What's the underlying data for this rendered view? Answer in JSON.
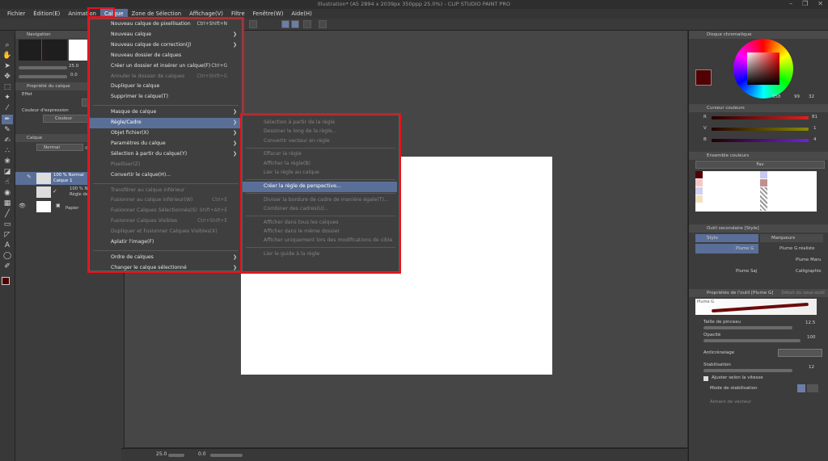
{
  "window": {
    "title": "Illustration* (A5 2894 x 2039px 350ppp 25.0%) - CLIP STUDIO PAINT PRO",
    "controls": [
      "–",
      "❐",
      "✕"
    ]
  },
  "menubar": [
    "Fichier",
    "Édition(E)",
    "Animation",
    "Calque",
    "Zone de Sélection",
    "Affichage(V)",
    "Filtre",
    "Fenêtre(W)",
    "Aide(H)"
  ],
  "calque_menu": {
    "items": [
      {
        "label": "Nouveau calque de pixellisation",
        "shortcut": "Ctrl+Shift+N"
      },
      {
        "label": "Nouveau calque",
        "arrow": true
      },
      {
        "label": "Nouveau calque de correction(J)",
        "arrow": true
      },
      {
        "label": "Nouveau dossier de calques"
      },
      {
        "label": "Créer un dossier et insérer un calque(F)",
        "shortcut": "Ctrl+G"
      },
      {
        "label": "Annuler le dossier de calques",
        "shortcut": "Ctrl+Shift+G",
        "disabled": true
      },
      {
        "label": "Dupliquer le calque"
      },
      {
        "label": "Supprimer le calque(T)"
      },
      {
        "separator": true
      },
      {
        "label": "Masque de calque",
        "arrow": true
      },
      {
        "label": "Règle/Cadre",
        "arrow": true,
        "highlighted": true
      },
      {
        "label": "Objet fichier(X)",
        "arrow": true
      },
      {
        "label": "Paramètres du calque",
        "arrow": true
      },
      {
        "label": "Sélection à partir du calque(Y)",
        "arrow": true
      },
      {
        "label": "Pixelliser(Z)",
        "disabled": true
      },
      {
        "label": "Convertir le calque(H)..."
      },
      {
        "separator": true
      },
      {
        "label": "Transférer au calque inférieur",
        "disabled": true
      },
      {
        "label": "Fusionner au calque inférieur(W)",
        "shortcut": "Ctrl+E",
        "disabled": true
      },
      {
        "label": "Fusionner Calques Sélectionnés(S)",
        "shortcut": "Shift+Alt+E",
        "disabled": true
      },
      {
        "label": "Fusionner Calques Visibles",
        "shortcut": "Ctrl+Shift+E",
        "disabled": true
      },
      {
        "label": "Dupliquer et Fusionner Calques Visibles(X)",
        "disabled": true
      },
      {
        "label": "Aplatir l'image(F)"
      },
      {
        "separator": true
      },
      {
        "label": "Ordre de calques",
        "arrow": true
      },
      {
        "label": "Changer le calque sélectionné",
        "arrow": true
      }
    ]
  },
  "regle_submenu": {
    "items": [
      {
        "label": "Sélection à partir de la règle",
        "disabled": true
      },
      {
        "label": "Dessiner le long de la règle...",
        "disabled": true
      },
      {
        "label": "Convertir vecteur en règle",
        "disabled": true
      },
      {
        "separator": true
      },
      {
        "label": "Effacer la règle",
        "disabled": true
      },
      {
        "label": "Afficher la règle(B)",
        "disabled": true
      },
      {
        "label": "Lier la règle au calque",
        "disabled": true
      },
      {
        "separator": true
      },
      {
        "label": "Créer la règle de perspective...",
        "highlighted": true
      },
      {
        "separator": true
      },
      {
        "label": "Diviser la bordure de cadre de manière égale(T)...",
        "disabled": true
      },
      {
        "label": "Combiner des cadres(U)...",
        "disabled": true
      },
      {
        "separator": true
      },
      {
        "label": "Afficher dans tous les calques",
        "disabled": true
      },
      {
        "label": "Afficher dans le même dossier",
        "disabled": true
      },
      {
        "label": "Afficher uniquement lors des modifications de cible",
        "disabled": true
      },
      {
        "separator": true
      },
      {
        "label": "Lier le guide à la règle",
        "disabled": true
      }
    ]
  },
  "left_panel": {
    "navigation_title": "Navigation",
    "zoom_value": "25.0",
    "rotate_value": "0.0",
    "layer_props_title": "Propriété du calque",
    "effect_label": "Effet",
    "expression_color_label": "Couleur d'expression",
    "expression_color_value": "Couleur",
    "layer_title": "Calque",
    "blend_mode": "Normal",
    "layers": [
      {
        "opacity_mode": "100 % Normal",
        "name": "Calque 1"
      },
      {
        "opacity_mode": "100 % N",
        "name": "Règle de"
      },
      {
        "opacity_mode": "",
        "name": "Papier"
      }
    ]
  },
  "right_panel": {
    "color_wheel_title": "Disque chromatique",
    "hsv_values": [
      "358",
      "99",
      "32"
    ],
    "color_slider_title": "Curseur couleurs",
    "rgb": [
      {
        "label": "R",
        "value": "81",
        "color": "#e02020"
      },
      {
        "label": "V",
        "value": "1",
        "color": "#20c020"
      },
      {
        "label": "B",
        "value": "4",
        "color": "#3050e0"
      }
    ],
    "color_set_title": "Ensemble couleurs",
    "color_set_name": "Fav",
    "subtool_title": "Outil secondaire [Style]",
    "subtool_tabs": [
      "Stylo",
      "Marqueurs"
    ],
    "brushes": [
      "Plume G",
      "Plume G réaliste",
      "Plume Maru",
      "Calligraphie",
      "Plume Saj"
    ],
    "tool_props_title": "Propriétés de l'outil [Plume G]",
    "tool_props_tab2": "Détail du sous-outil",
    "brush_name": "Plume G",
    "brush_size_label": "Taille de pinceau",
    "brush_size_value": "12.5",
    "opacity_label": "Opacité",
    "opacity_value": "100",
    "aa_label": "Anticrénelage",
    "stab_label": "Stabilisation",
    "stab_value": "12",
    "speed_label": "Ajuster selon la vitesse",
    "stab_mode_label": "Mode de stabilisation",
    "vector_label": "Aimant de vecteur"
  },
  "status": {
    "zoom": "25.0",
    "rotation": "0.0"
  }
}
